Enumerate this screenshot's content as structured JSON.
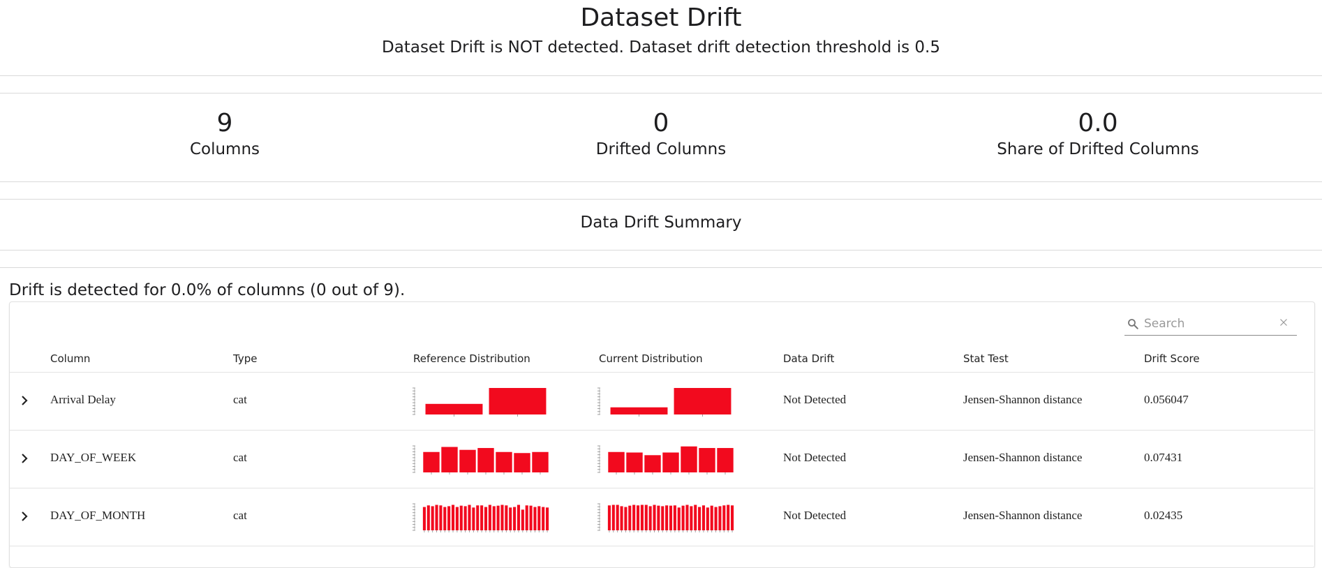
{
  "header": {
    "title": "Dataset Drift",
    "subtitle": "Dataset Drift is NOT detected. Dataset drift detection threshold is 0.5"
  },
  "counters": [
    {
      "value": "9",
      "label": "Columns"
    },
    {
      "value": "0",
      "label": "Drifted Columns"
    },
    {
      "value": "0.0",
      "label": "Share of Drifted Columns"
    }
  ],
  "summary": {
    "title": "Data Drift Summary",
    "drift_text": "Drift is detected for 0.0% of columns (0 out of 9)."
  },
  "search": {
    "placeholder": "Search"
  },
  "table": {
    "headers": [
      "Column",
      "Type",
      "Reference Distribution",
      "Current Distribution",
      "Data Drift",
      "Stat Test",
      "Drift Score"
    ],
    "rows": [
      {
        "column": "Arrival Delay",
        "type": "cat",
        "data_drift": "Not Detected",
        "stat_test": "Jensen-Shannon distance",
        "drift_score": "0.056047"
      },
      {
        "column": "DAY_OF_WEEK",
        "type": "cat",
        "data_drift": "Not Detected",
        "stat_test": "Jensen-Shannon distance",
        "drift_score": "0.07431"
      },
      {
        "column": "DAY_OF_MONTH",
        "type": "cat",
        "data_drift": "Not Detected",
        "stat_test": "Jensen-Shannon distance",
        "drift_score": "0.02435"
      }
    ]
  },
  "distributions": [
    {
      "reference": [
        0.4,
        1.0
      ],
      "current": [
        0.27,
        1.0
      ]
    },
    {
      "reference": [
        0.77,
        0.96,
        0.85,
        0.92,
        0.77,
        0.73,
        0.77
      ],
      "current": [
        0.77,
        0.75,
        0.65,
        0.75,
        0.98,
        0.92,
        0.92
      ]
    },
    {
      "reference": [
        0.88,
        0.94,
        0.91,
        0.96,
        0.94,
        0.88,
        0.91,
        0.96,
        0.88,
        0.93,
        0.91,
        0.96,
        0.86,
        0.94,
        0.94,
        0.88,
        0.96,
        0.91,
        0.93,
        0.96,
        0.94,
        0.86,
        0.88,
        0.96,
        0.78,
        0.94,
        0.93,
        0.88,
        0.91,
        0.88,
        0.86
      ],
      "current": [
        0.94,
        0.96,
        0.96,
        0.91,
        0.88,
        0.93,
        0.96,
        0.94,
        0.96,
        0.96,
        0.91,
        0.96,
        0.93,
        0.91,
        0.94,
        0.93,
        0.94,
        0.86,
        0.93,
        0.96,
        0.91,
        0.96,
        0.88,
        0.94,
        0.86,
        0.93,
        0.88,
        0.91,
        0.94,
        0.96,
        0.94
      ]
    }
  ],
  "colors": {
    "bar": "#f20a1e",
    "accent_text": "#1d1d1f"
  },
  "icons": {
    "search": "search-icon",
    "clear": "close-icon",
    "expand": "chevron-right-icon"
  }
}
